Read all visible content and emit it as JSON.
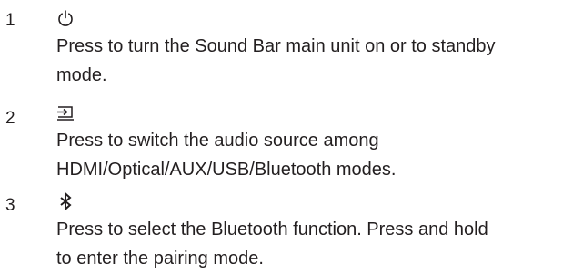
{
  "items": [
    {
      "number": "1",
      "icon": "power-icon",
      "lines": [
        "Press to turn the Sound Bar main unit on or to standby",
        "mode."
      ]
    },
    {
      "number": "2",
      "icon": "input-source-icon",
      "lines": [
        "Press to switch the audio source among",
        "HDMI/Optical/AUX/USB/Bluetooth modes."
      ]
    },
    {
      "number": "3",
      "icon": "bluetooth-icon",
      "lines": [
        "Press to select the Bluetooth function. Press and hold",
        "to enter the pairing mode."
      ]
    }
  ],
  "colors": {
    "text": "#231f20",
    "background": "#ffffff"
  }
}
